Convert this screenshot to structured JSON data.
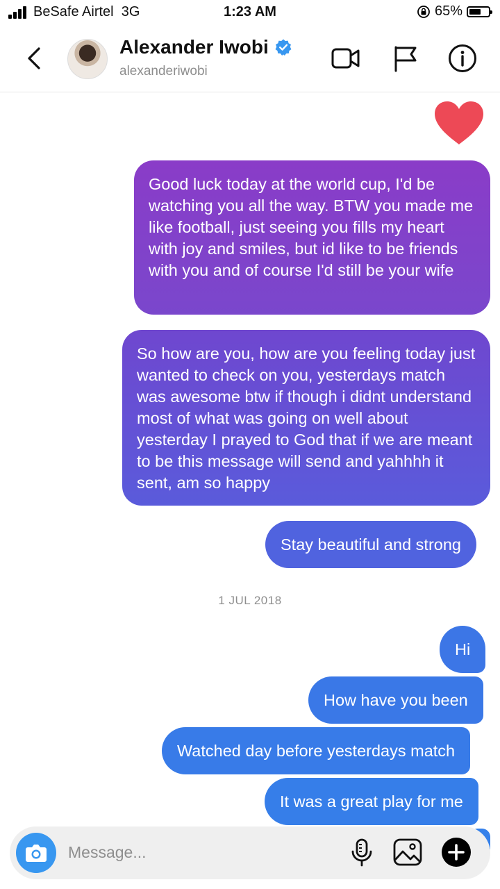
{
  "status": {
    "carrier": "BeSafe Airtel",
    "network": "3G",
    "time": "1:23 AM",
    "battery": "65%",
    "battery_level": 0.65
  },
  "header": {
    "name": "Alexander Iwobi",
    "username": "alexanderiwobi"
  },
  "messages": [
    {
      "text": "Good luck today at the world cup, I'd be watching you all the way. BTW you made me like football, just seeing you fills my heart with joy and smiles, but id like to be friends with you and of course I'd still be your wife"
    },
    {
      "text": "So how are you, how are you feeling today just wanted to check on you, yesterdays match was awesome btw if though i didnt understand most of what was going on well about yesterday I prayed to God that if we are meant to be this message will send and yahhhh it sent, am so happy"
    },
    {
      "text": "Stay beautiful and strong"
    },
    {
      "text": "Hi"
    },
    {
      "text": "How have you been"
    },
    {
      "text": "Watched day before yesterdays match"
    },
    {
      "text": "It was a great play for me"
    }
  ],
  "date_separator": "1 JUL 2018",
  "composer": {
    "placeholder": "Message..."
  },
  "colors": {
    "heart": "#ed4956",
    "accent_blue": "#3897f0",
    "verified": "#3897f0"
  }
}
